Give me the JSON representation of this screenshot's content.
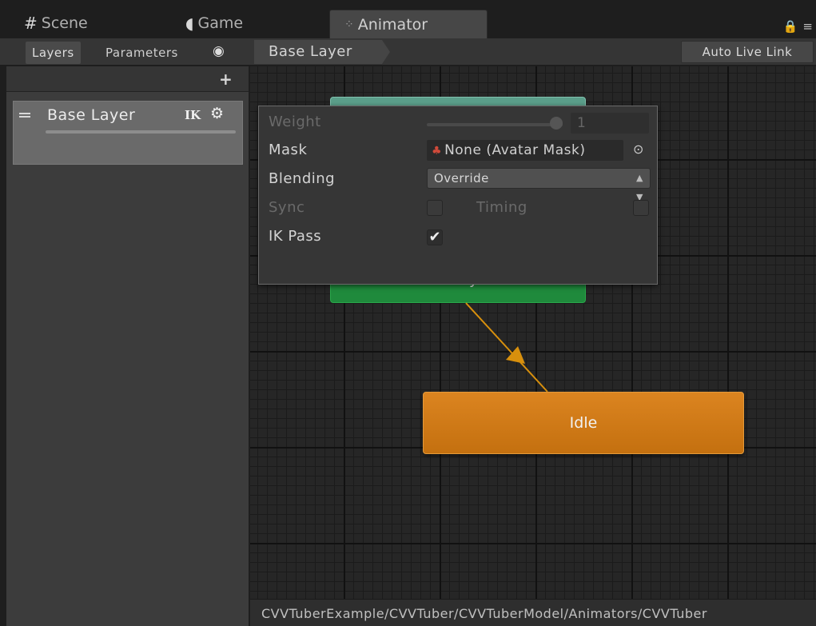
{
  "tabs": {
    "scene": {
      "label": "Scene",
      "icon": "grid-hash-icon"
    },
    "game": {
      "label": "Game",
      "icon": "pacman-icon"
    },
    "animator": {
      "label": "Animator",
      "icon": "animator-icon",
      "active": true
    }
  },
  "toolbar": {
    "layers_label": "Layers",
    "parameters_label": "Parameters",
    "breadcrumb": "Base Layer",
    "auto_live_link_label": "Auto Live Link"
  },
  "layers_panel": {
    "add_icon": "plus-icon",
    "layers": [
      {
        "name": "Base Layer",
        "ik_label": "IK",
        "settings_icon": "gear-icon"
      }
    ]
  },
  "layer_settings": {
    "weight_label": "Weight",
    "weight_value": "1",
    "mask_label": "Mask",
    "mask_value": "None (Avatar Mask)",
    "blending_label": "Blending",
    "blending_value": "Override",
    "sync_label": "Sync",
    "sync_checked": false,
    "timing_label": "Timing",
    "timing_checked": false,
    "ik_pass_label": "IK Pass",
    "ik_pass_checked": true
  },
  "graph": {
    "nodes": {
      "entry": {
        "label": "Entry",
        "color": "#1f8a3c"
      },
      "any_state": {
        "label": "",
        "color": "#5b9e8a"
      },
      "idle": {
        "label": "Idle",
        "color": "#d27a18"
      }
    },
    "transition_color": "#d8900d"
  },
  "status_path": "CVVTuberExample/CVVTuber/CVVTuberModel/Animators/CVVTuber"
}
